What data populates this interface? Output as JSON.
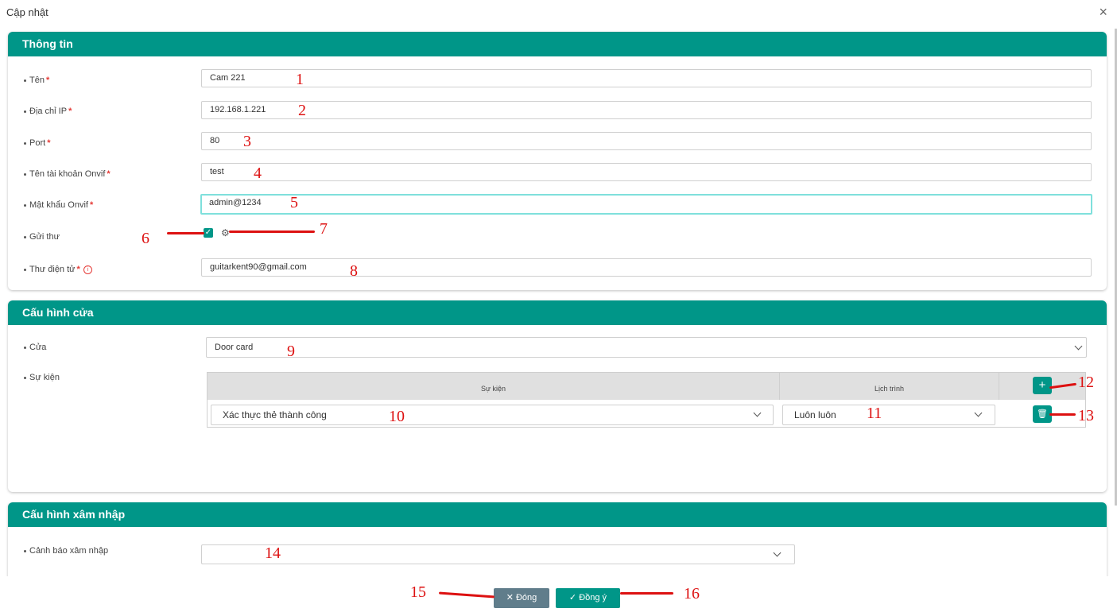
{
  "dialog": {
    "title": "Cập nhật",
    "close_icon": "×"
  },
  "sections": {
    "info": {
      "title": "Thông tin"
    },
    "door": {
      "title": "Cấu hình cửa"
    },
    "intrusion": {
      "title": "Cấu hình xâm nhập"
    }
  },
  "fields": {
    "name": {
      "label": "Tên",
      "value": "Cam 221"
    },
    "ip": {
      "label": "Địa chỉ IP",
      "value": "192.168.1.221"
    },
    "port": {
      "label": "Port",
      "value": "80"
    },
    "onvif_user": {
      "label": "Tên tài khoản Onvif",
      "value": "test"
    },
    "onvif_pass": {
      "label": "Mật khẩu Onvif",
      "value": "admin@1234"
    },
    "send_mail": {
      "label": "Gửi thư",
      "checked": true
    },
    "email": {
      "label": "Thư điện tử",
      "value": "guitarkent90@gmail.com"
    },
    "door": {
      "label": "Cửa",
      "value": "Door card"
    },
    "events": {
      "label": "Sự kiện"
    },
    "intrusion_alert": {
      "label": "Cảnh báo xâm nhập",
      "value": ""
    }
  },
  "required_mark": "*",
  "info_icon_glyph": "i",
  "events_table": {
    "headers": {
      "event": "Sự kiện",
      "schedule": "Lịch trình"
    },
    "rows": [
      {
        "event": "Xác thực thẻ thành công",
        "schedule": "Luôn luôn"
      }
    ],
    "add_glyph": "+",
    "delete_glyph": "🗑"
  },
  "buttons": {
    "close": "Đóng",
    "ok": "Đồng ý",
    "close_glyph": "✕",
    "ok_glyph": "✓"
  },
  "annotations": [
    "1",
    "2",
    "3",
    "4",
    "5",
    "6",
    "7",
    "8",
    "9",
    "10",
    "11",
    "12",
    "13",
    "14",
    "15",
    "16"
  ],
  "colors": {
    "accent": "#009688",
    "annotation": "#dd1111",
    "close_button": "#607d8b"
  }
}
